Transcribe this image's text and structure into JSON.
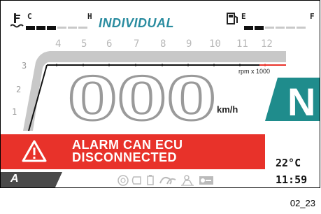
{
  "header": {
    "mode_title": "INDIVIDUAL",
    "temp_gauge": {
      "low_label": "C",
      "high_label": "H",
      "icon": "coolant-temperature-icon"
    },
    "fuel_gauge": {
      "low_label": "E",
      "high_label": "F",
      "icon": "fuel-pump-icon"
    }
  },
  "tachometer": {
    "top_scale": [
      "4",
      "5",
      "6",
      "7",
      "8",
      "9",
      "10",
      "11",
      "12"
    ],
    "left_scale": [
      "3",
      "2",
      "1"
    ],
    "unit": "rpm x 1000"
  },
  "speed": {
    "value": "000",
    "unit": "km/h"
  },
  "gear": {
    "value": "N",
    "color": "#1f8c8c"
  },
  "alarm": {
    "line1": "ALARM CAN ECU",
    "line2": "DISCONNECTED",
    "icon": "warning-triangle-icon",
    "color": "#e8322a"
  },
  "status_bar": {
    "riding_mode": "A",
    "indicator_icons": [
      "abs-icon",
      "light-icon",
      "battery-icon",
      "traction-icon",
      "rider-icon",
      "key-icon"
    ]
  },
  "readouts": {
    "temperature": "22°C",
    "time": "11:59"
  },
  "caption": "02_23"
}
